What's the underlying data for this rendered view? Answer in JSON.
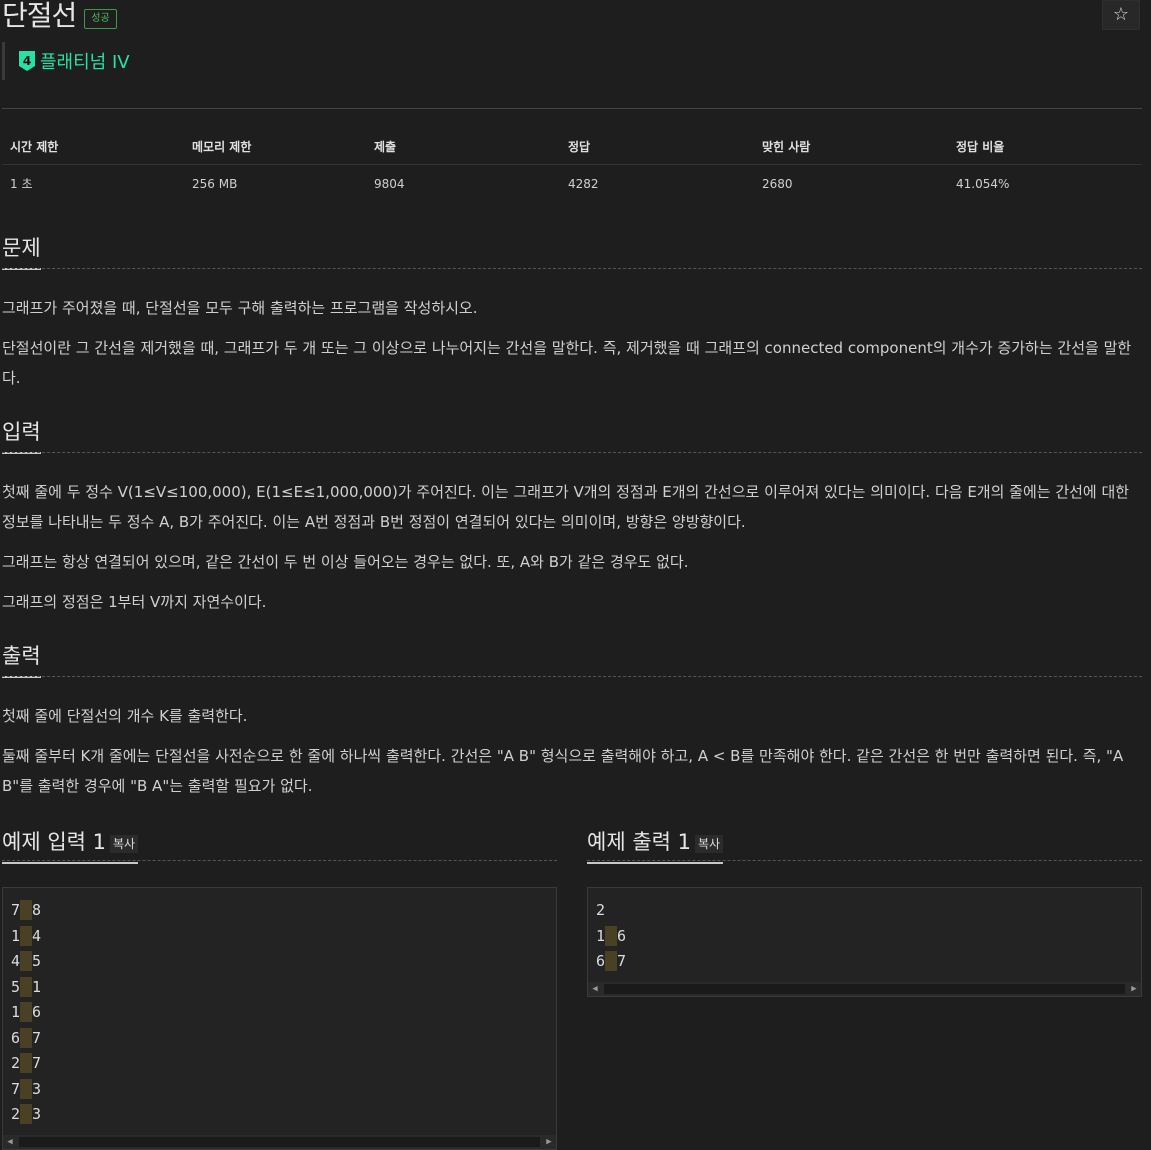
{
  "problem": {
    "title": "단절선",
    "status_badge": "성공",
    "star": "☆",
    "tier_number": "4",
    "tier_label": "플래티넘 IV"
  },
  "info_table": {
    "headers": [
      "시간 제한",
      "메모리 제한",
      "제출",
      "정답",
      "맞힌 사람",
      "정답 비율"
    ],
    "values": [
      "1 초",
      "256 MB",
      "9804",
      "4282",
      "2680",
      "41.054%"
    ]
  },
  "sections": {
    "problem": {
      "heading": "문제",
      "paragraphs": [
        "그래프가 주어졌을 때, 단절선을 모두 구해 출력하는 프로그램을 작성하시오.",
        "단절선이란 그 간선을 제거했을 때, 그래프가 두 개 또는 그 이상으로 나누어지는 간선을 말한다. 즉, 제거했을 때 그래프의 connected component의 개수가 증가하는 간선을 말한다."
      ]
    },
    "input": {
      "heading": "입력",
      "paragraphs": [
        "첫째 줄에 두 정수 V(1≤V≤100,000), E(1≤E≤1,000,000)가 주어진다. 이는 그래프가 V개의 정점과 E개의 간선으로 이루어져 있다는 의미이다. 다음 E개의 줄에는 간선에 대한 정보를 나타내는 두 정수 A, B가 주어진다. 이는 A번 정점과 B번 정점이 연결되어 있다는 의미이며, 방향은 양방향이다.",
        "그래프는 항상 연결되어 있으며, 같은 간선이 두 번 이상 들어오는 경우는 없다. 또, A와 B가 같은 경우도 없다.",
        "그래프의 정점은 1부터 V까지 자연수이다."
      ]
    },
    "output": {
      "heading": "출력",
      "paragraphs": [
        "첫째 줄에 단절선의 개수 K를 출력한다.",
        "둘째 줄부터 K개 줄에는 단절선을 사전순으로 한 줄에 하나씩 출력한다. 간선은 \"A B\" 형식으로 출력해야 하고, A < B를 만족해야 한다. 같은 간선은 한 번만 출력하면 된다. 즉, \"A B\"를 출력한 경우에 \"B A\"는 출력할 필요가 없다."
      ]
    }
  },
  "samples": {
    "input_heading": "예제 입력 1",
    "output_heading": "예제 출력 1",
    "copy_label": "복사",
    "input_lines": [
      [
        "7",
        "8"
      ],
      [
        "1",
        "4"
      ],
      [
        "4",
        "5"
      ],
      [
        "5",
        "1"
      ],
      [
        "1",
        "6"
      ],
      [
        "6",
        "7"
      ],
      [
        "2",
        "7"
      ],
      [
        "7",
        "3"
      ],
      [
        "2",
        "3"
      ]
    ],
    "output_lines": [
      [
        "2"
      ],
      [
        "1",
        "6"
      ],
      [
        "6",
        "7"
      ]
    ]
  },
  "scrollbar": {
    "left_arrow": "◀",
    "right_arrow": "▶"
  }
}
